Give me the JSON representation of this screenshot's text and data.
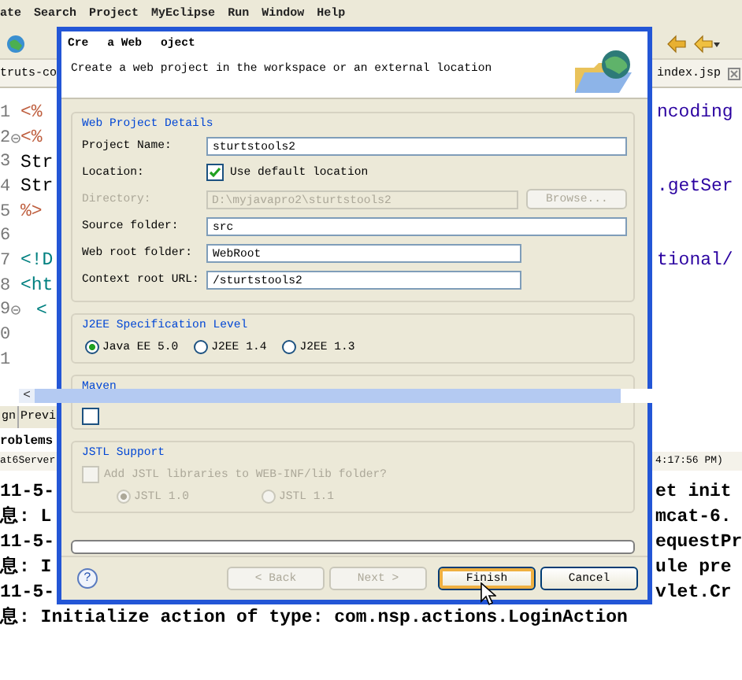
{
  "menu_bar": {
    "items": [
      "ate",
      "Search",
      "Project",
      "MyEclipse",
      "Run",
      "Window",
      "Help"
    ]
  },
  "editor_tabs": {
    "left": "truts-co",
    "right": "index.jsp"
  },
  "editor": {
    "lines": [
      {
        "number": "1",
        "code": "<%",
        "kind": "jsp",
        "right": "ncoding"
      },
      {
        "number": "2",
        "code": "<%",
        "kind": "jsp",
        "fold": true
      },
      {
        "number": "3",
        "code": "Str",
        "kind": "java"
      },
      {
        "number": "4",
        "code": "Str",
        "kind": "java",
        "right": ".getSer"
      },
      {
        "number": "5",
        "code": "%>",
        "kind": "jsp"
      },
      {
        "number": "6"
      },
      {
        "number": "7",
        "code": "<!D",
        "kind": "html",
        "right": "tional/"
      },
      {
        "number": "8",
        "code": "<ht",
        "kind": "html"
      },
      {
        "number": "9",
        "code": "<",
        "kind": "html",
        "fold": true,
        "indent": true
      },
      {
        "number": "0"
      },
      {
        "number": "1"
      }
    ]
  },
  "scroll_left": "<",
  "bottom_tabs": [
    "gn",
    "Previ"
  ],
  "problems_label": "roblems",
  "console": {
    "title": "at6Server",
    "time": "4:17:56 PM)",
    "lines": [
      {
        "left": "11-5-",
        "right": "et init"
      },
      {
        "left": "息: L",
        "right": "mcat-6."
      },
      {
        "left": "11-5-",
        "right": "equestPr"
      },
      {
        "left": "息: I",
        "right": "ule pre"
      },
      {
        "left": "11-5-",
        "right": "vlet.Cr"
      },
      {
        "left": "息: Initialize action of type: com.nsp.actions.LoginAction"
      }
    ]
  },
  "dialog": {
    "title_fragments": [
      "Cre",
      "a Web",
      "oject"
    ],
    "description": "Create a web project in the workspace or an external location",
    "details": {
      "title": "Web Project Details",
      "rows": [
        {
          "kind": "text",
          "label": "Project Name:",
          "value": "sturtstools2"
        },
        {
          "kind": "checkbox",
          "label": "Location:",
          "option": "Use default location",
          "checked": true
        },
        {
          "kind": "directory",
          "label": "Directory:",
          "value": "D:\\myjavapro2\\sturtstools2",
          "button": "Browse...",
          "disabled": true
        },
        {
          "kind": "text",
          "label": "Source folder:",
          "value": "src"
        },
        {
          "kind": "text_short",
          "label": "Web root folder:",
          "value": "WebRoot"
        },
        {
          "kind": "text_short",
          "label": "Context root URL:",
          "value": "/sturtstools2"
        }
      ]
    },
    "j2ee": {
      "title": "J2EE Specification Level",
      "options": [
        {
          "label": "Java EE 5.0",
          "selected": true
        },
        {
          "label": "J2EE 1.4",
          "selected": false
        },
        {
          "label": "J2EE 1.3",
          "selected": false
        }
      ]
    },
    "maven": {
      "title": "Maven",
      "checked": false
    },
    "jstl": {
      "title": "JSTL Support",
      "checkbox": {
        "label": "Add JSTL libraries to WEB-INF/lib folder?",
        "checked": false
      },
      "disabled": true,
      "options": [
        {
          "label": "JSTL 1.0",
          "selected": true
        },
        {
          "label": "JSTL 1.1",
          "selected": false
        }
      ]
    },
    "progress": {
      "level": 0
    },
    "help": "?",
    "buttons": [
      {
        "label": "< Back",
        "disabled": true,
        "default": false
      },
      {
        "label": "Next >",
        "disabled": true,
        "default": false
      },
      {
        "label": "Finish",
        "disabled": false,
        "default": true
      },
      {
        "label": "Cancel",
        "disabled": false,
        "default": false
      }
    ]
  }
}
